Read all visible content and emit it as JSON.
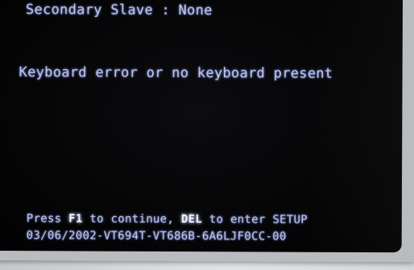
{
  "screen": {
    "secondary_slave": "Secondary Slave : None",
    "error_message": "Keyboard error or no keyboard present",
    "prompt": {
      "press": "Press",
      "key_continue": "F1",
      "to_continue": "to continue,",
      "key_setup": "DEL",
      "to_enter": "to enter SETUP"
    },
    "bios_string": "03/06/2002-VT694T-VT686B-6A6LJF0CC-00"
  },
  "colors": {
    "text": "#b9c2f0",
    "highlight": "#eef0ff",
    "screen_background": "#050506",
    "bezel": "#b9bcbf"
  }
}
